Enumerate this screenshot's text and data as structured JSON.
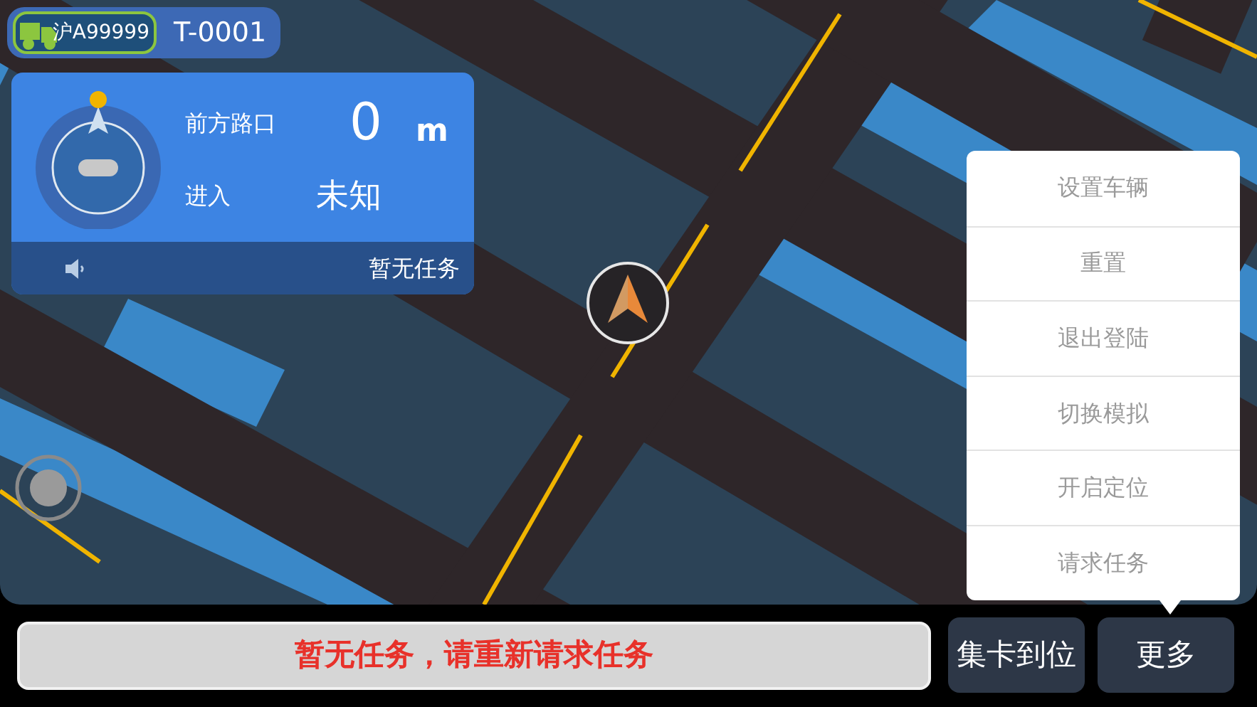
{
  "vehicle": {
    "plate": "沪A99999",
    "id": "T-0001"
  },
  "nav_card": {
    "ahead_label": "前方路口",
    "distance": "0",
    "unit": "m",
    "enter_label": "进入",
    "enter_value": "未知",
    "task_status": "暂无任务"
  },
  "menu": {
    "items": [
      {
        "label": "设置车辆"
      },
      {
        "label": "重置"
      },
      {
        "label": "退出登陆"
      },
      {
        "label": "切换模拟"
      },
      {
        "label": "开启定位"
      },
      {
        "label": "请求任务"
      }
    ]
  },
  "bottom_bar": {
    "message": "暂无任务，请重新请求任务",
    "buttons": [
      "集卡到位",
      "更多"
    ]
  }
}
